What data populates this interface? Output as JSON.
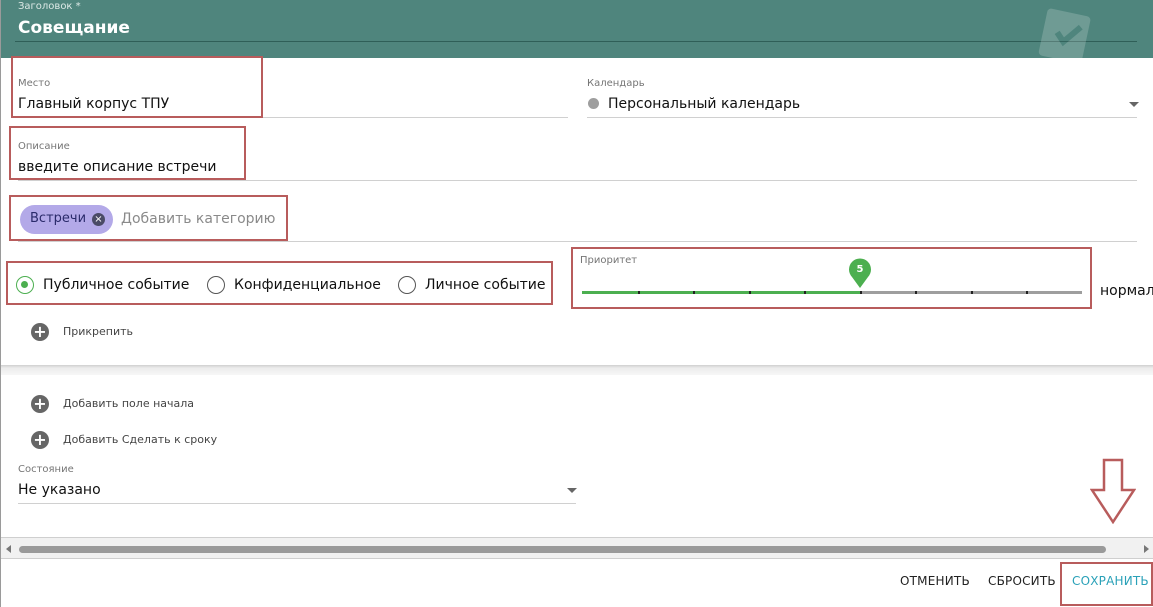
{
  "header": {
    "title_label": "Заголовок *",
    "title_value": "Совещание"
  },
  "place": {
    "label": "Место",
    "value": "Главный корпус ТПУ"
  },
  "calendar": {
    "label": "Календарь",
    "value": "Персональный календарь"
  },
  "description": {
    "label": "Описание",
    "placeholder": "введите описание встречи"
  },
  "categories": {
    "chip": "Встречи",
    "add_placeholder": "Добавить категорию"
  },
  "visibility": {
    "options": [
      "Публичное событие",
      "Конфиденциальное",
      "Личное событие"
    ],
    "selected": "Публичное событие"
  },
  "priority": {
    "label": "Приоритет",
    "value": "5",
    "text": "нормаль",
    "max": 9,
    "fill_fraction": 0.5556
  },
  "attach": {
    "label": "Прикрепить"
  },
  "add_start": {
    "label": "Добавить поле начала"
  },
  "add_due": {
    "label": "Добавить Сделать к сроку"
  },
  "state": {
    "label": "Состояние",
    "value": "Не указано"
  },
  "footer": {
    "cancel": "ОТМЕНИТЬ",
    "reset": "СБРОСИТЬ",
    "save": "СОХРАНИТЬ"
  },
  "colors": {
    "header": "#4f857d",
    "accent_green": "#4caf50",
    "chip": "#b3a9e8",
    "save": "#2aa1b8",
    "annotation": "#b85c5c"
  }
}
